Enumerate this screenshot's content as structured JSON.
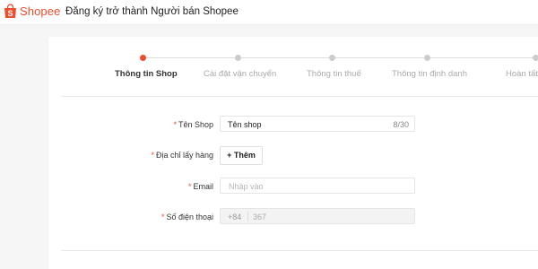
{
  "header": {
    "logo_text": "Shopee",
    "title": "Đăng ký trở thành Người bán Shopee",
    "brand_color": "#ee4d2d"
  },
  "steps": [
    {
      "label": "Thông tin Shop",
      "active": true
    },
    {
      "label": "Cài đặt vận chuyển",
      "active": false
    },
    {
      "label": "Thông tin thuế",
      "active": false
    },
    {
      "label": "Thông tin định danh",
      "active": false
    },
    {
      "label": "Hoàn tất",
      "active": false
    }
  ],
  "form": {
    "required_mark": "*",
    "shop_name": {
      "label": "Tên Shop",
      "value": "Tên shop",
      "counter": "8/30"
    },
    "pickup_address": {
      "label": "Địa chỉ lấy hàng",
      "button": "+ Thêm"
    },
    "email": {
      "label": "Email",
      "placeholder": "Nhập vào"
    },
    "phone": {
      "label": "Số điện thoại",
      "prefix": "+84",
      "value": "367"
    }
  }
}
